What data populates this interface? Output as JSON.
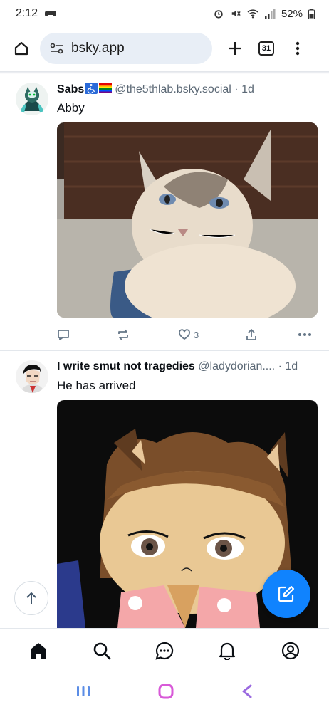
{
  "status_bar": {
    "time": "2:12",
    "battery": "52%"
  },
  "browser": {
    "url": "bsky.app",
    "tab_count": "31"
  },
  "posts": [
    {
      "display_name": "Sabs",
      "handle": "@the5thlab.bsky.social",
      "time": "· 1d",
      "text": "Abby",
      "like_count": "3"
    },
    {
      "display_name": "I write smut not tragedies",
      "handle": "@ladydorian....",
      "time": "· 1d",
      "text": "He has arrived"
    }
  ],
  "colors": {
    "accent": "#1083fe",
    "nav_icon": "#0b0f14",
    "action_icon": "#667788",
    "url_bar_bg": "#e8eef6"
  },
  "icons": {
    "bottom_nav": [
      "home-icon",
      "search-icon",
      "chat-icon",
      "bell-icon",
      "profile-icon"
    ],
    "post_actions": [
      "reply-icon",
      "repost-icon",
      "like-icon",
      "share-icon",
      "more-icon"
    ]
  }
}
